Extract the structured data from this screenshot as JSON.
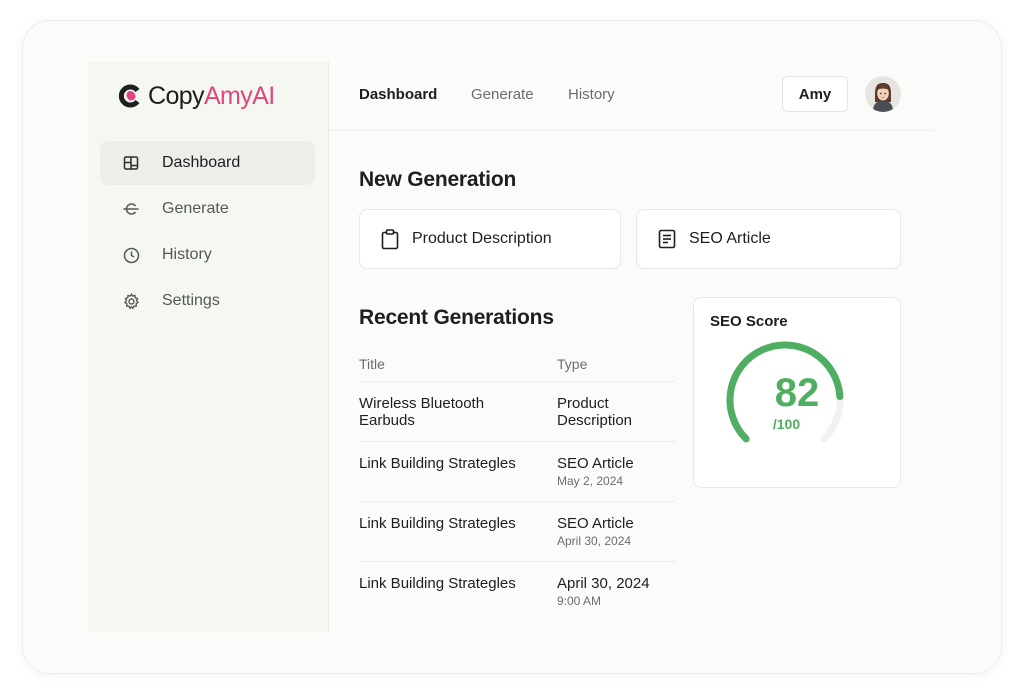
{
  "brand": {
    "name_part1": "Copy",
    "name_part2": "AmyAI",
    "accent": "#e2457f"
  },
  "sidebar": {
    "items": [
      {
        "label": "Dashboard",
        "icon": "dashboard-icon",
        "active": true
      },
      {
        "label": "Generate",
        "icon": "generate-icon",
        "active": false
      },
      {
        "label": "History",
        "icon": "clock-icon",
        "active": false
      },
      {
        "label": "Settings",
        "icon": "gear-icon",
        "active": false
      }
    ]
  },
  "header": {
    "tabs": [
      {
        "label": "Dashboard",
        "active": true
      },
      {
        "label": "Generate",
        "active": false
      },
      {
        "label": "History",
        "active": false
      }
    ],
    "user_name": "Amy",
    "avatar_icon": "avatar"
  },
  "new_generation": {
    "title": "New Generation",
    "options": [
      {
        "label": "Product Description",
        "icon": "clipboard-icon"
      },
      {
        "label": "SEO Article",
        "icon": "document-icon"
      }
    ]
  },
  "recent": {
    "title": "Recent Generations",
    "columns": [
      "Title",
      "Type"
    ],
    "rows": [
      {
        "title": "Wireless Bluetooth Earbuds",
        "type": "Product Description",
        "sub": ""
      },
      {
        "title": "Link Building Strategles",
        "type": "SEO Article",
        "sub": "May 2, 2024"
      },
      {
        "title": "Link Building Strategles",
        "type": "SEO Article",
        "sub": "April 30, 2024"
      },
      {
        "title": "Link Building Strategles",
        "type": "April 30, 2024",
        "sub": "9:00 AM"
      }
    ]
  },
  "seo_score": {
    "title": "SEO Score",
    "value": "82",
    "max_label": "/100",
    "fraction": 0.82,
    "color": "#4fae62"
  }
}
